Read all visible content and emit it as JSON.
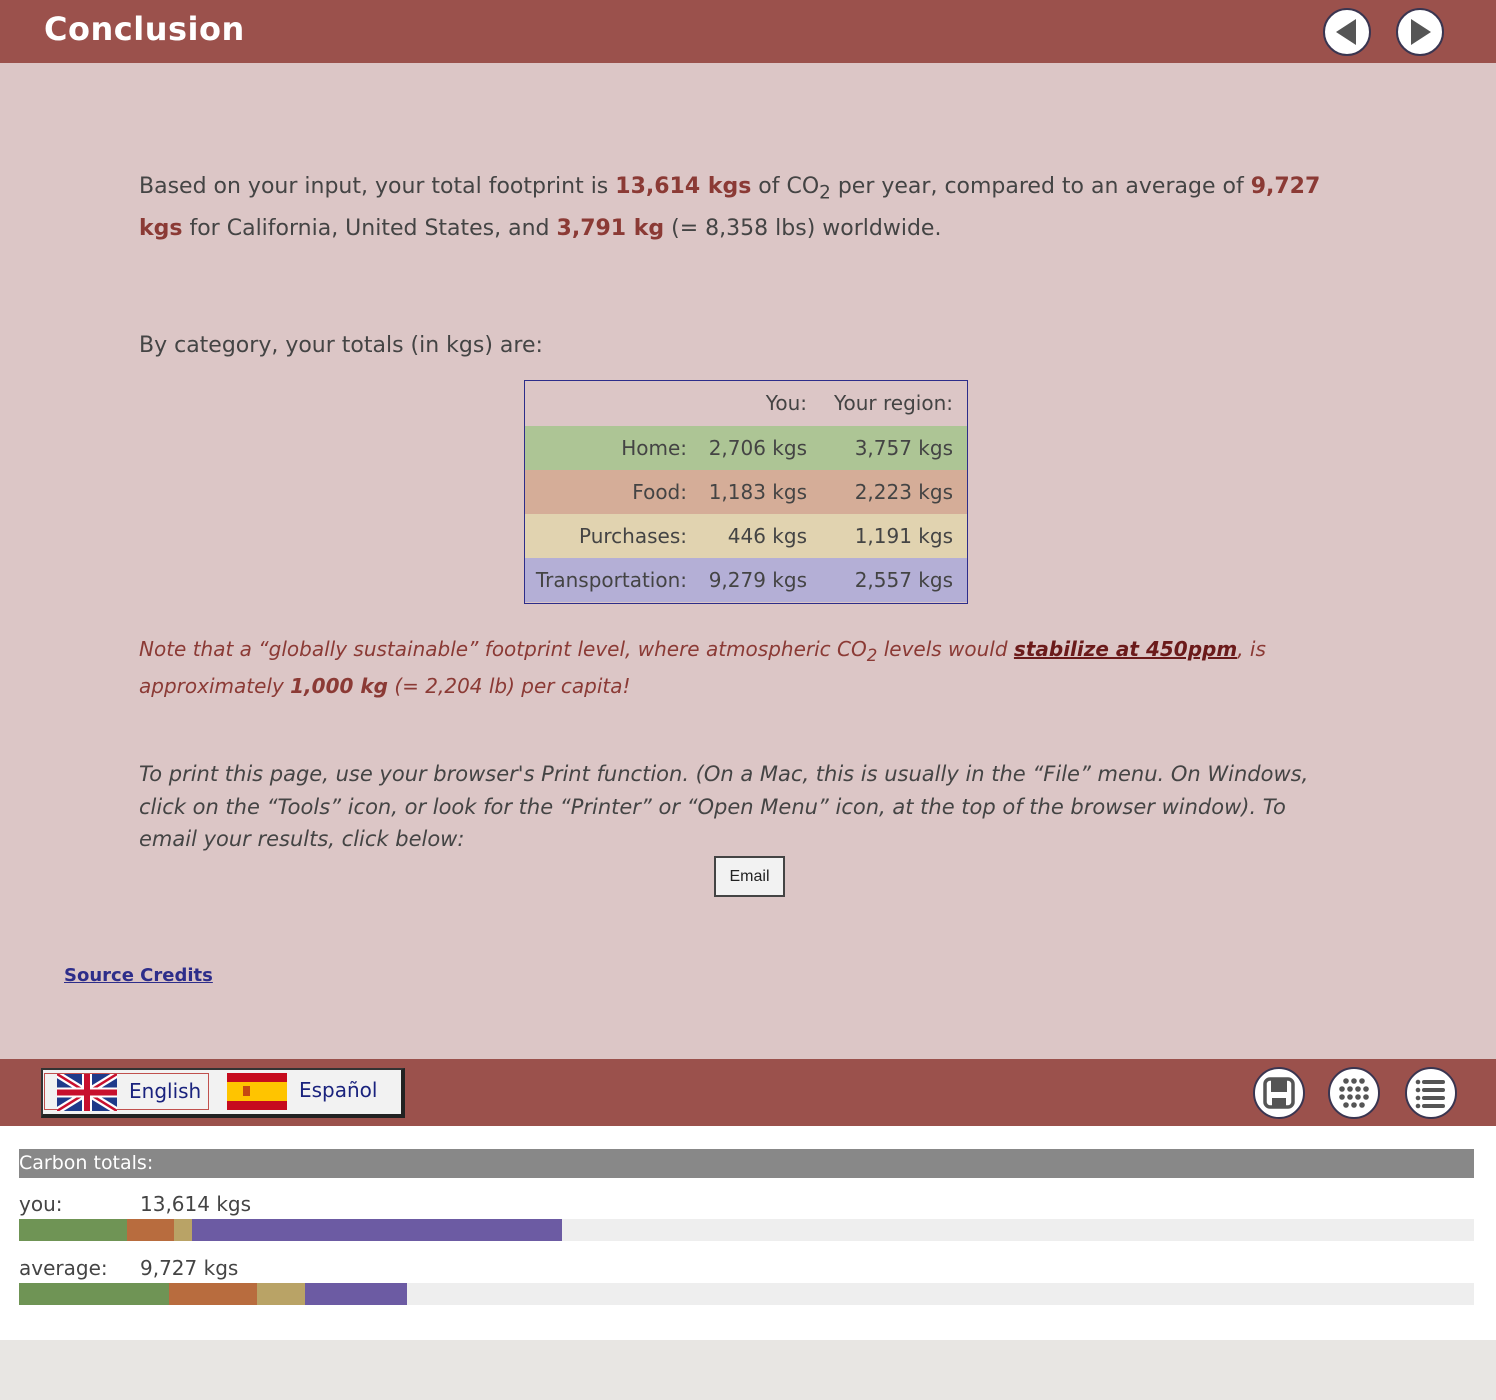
{
  "header": {
    "title": "Conclusion"
  },
  "summary": {
    "p_before": "Based on your input, your total footprint is ",
    "total_you": "13,614 kgs",
    "p_co2": " of CO",
    "p_sub": "2",
    "p_mid": " per year, compared to an average of ",
    "total_region": "9,727 kgs",
    "p_region_tail": " for California, United States, and ",
    "total_world": "3,791 kg",
    "p_end": " (= 8,358 lbs) worldwide."
  },
  "category_intro": "By category, your totals (in kgs) are:",
  "table": {
    "headers": [
      "",
      "You:",
      "Your region:"
    ],
    "rows": [
      {
        "label": "Home:",
        "you": "2,706 kgs",
        "region": "3,757 kgs",
        "color": "#adc595"
      },
      {
        "label": "Food:",
        "you": "1,183 kgs",
        "region": "2,223 kgs",
        "color": "#d5ad98"
      },
      {
        "label": "Purchases:",
        "you": "446 kgs",
        "region": "1,191 kgs",
        "color": "#e1d3b0"
      },
      {
        "label": "Transportation:",
        "you": "9,279 kgs",
        "region": "2,557 kgs",
        "color": "#b4afd6"
      }
    ]
  },
  "note": {
    "t1": "Note that a “globally sustainable” footprint level, where atmospheric CO",
    "sub": "2",
    "t2": " levels would ",
    "link": "stabilize at 450ppm",
    "t3": ", is approximately ",
    "bold": "1,000 kg",
    "t4": " (= 2,204 lb) per capita!"
  },
  "print_text": "To print this page, use your browser's Print function.  (On a Mac, this is usually in the “File” menu. On Windows, click on the “Tools” icon, or look for the “Printer” or “Open Menu” icon, at the top of the browser window).  To email your results, click below:",
  "email_button": "Email",
  "source_credits": "Source Credits",
  "languages": [
    {
      "label": "English",
      "flag": "uk-flag-icon",
      "selected": true
    },
    {
      "label": "Español",
      "flag": "spain-flag-icon",
      "selected": false
    }
  ],
  "icons": [
    "save-icon",
    "grid-icon",
    "list-icon"
  ],
  "colors": {
    "brand": "#9b514c",
    "background": "#dcc6c6",
    "highlight": "#8b3a35",
    "home": "#6f9455",
    "food": "#b86c3e",
    "purchases": "#b9a366",
    "transportation": "#6c5ba3"
  },
  "totals": {
    "header": "Carbon totals:",
    "you": {
      "label": "you:",
      "value": "13,614 kgs"
    },
    "average": {
      "label": "average:",
      "value": "9,727 kgs"
    }
  },
  "chart_data": {
    "type": "bar",
    "stacked": true,
    "orientation": "horizontal",
    "categories": [
      "you",
      "average"
    ],
    "series": [
      {
        "name": "Home",
        "values": [
          2706,
          3757
        ]
      },
      {
        "name": "Food",
        "values": [
          1183,
          2223
        ]
      },
      {
        "name": "Purchases",
        "values": [
          446,
          1191
        ]
      },
      {
        "name": "Transportation",
        "values": [
          9279,
          2557
        ]
      }
    ],
    "xlim": [
      0,
      36500
    ]
  }
}
